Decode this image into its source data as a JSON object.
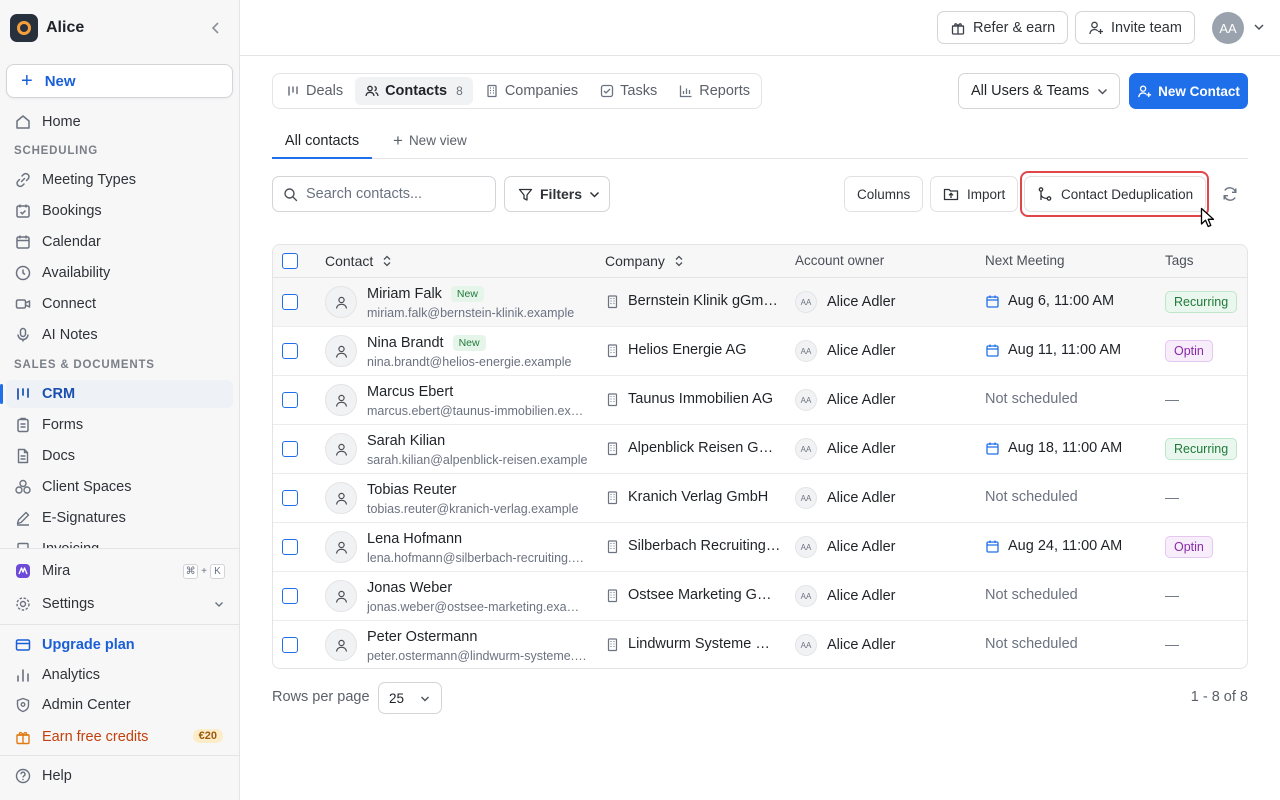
{
  "workspace": {
    "name": "Alice"
  },
  "sidebar": {
    "new_label": "New",
    "home_label": "Home",
    "section_scheduling": "SCHEDULING",
    "section_sales": "SALES & DOCUMENTS",
    "items": [
      {
        "label": "Meeting Types",
        "icon": "link-icon"
      },
      {
        "label": "Bookings",
        "icon": "calendar-check-icon"
      },
      {
        "label": "Calendar",
        "icon": "calendar-icon"
      },
      {
        "label": "Availability",
        "icon": "clock-icon"
      },
      {
        "label": "Connect",
        "icon": "video-icon"
      },
      {
        "label": "AI Notes",
        "icon": "mic-icon"
      },
      {
        "label": "CRM",
        "icon": "crm-icon",
        "active": true
      },
      {
        "label": "Forms",
        "icon": "clipboard-icon"
      },
      {
        "label": "Docs",
        "icon": "doc-icon"
      },
      {
        "label": "Client Spaces",
        "icon": "grid-icon"
      },
      {
        "label": "E-Signatures",
        "icon": "pen-icon"
      },
      {
        "label": "Invoicing",
        "icon": "invoice-icon"
      }
    ],
    "mira_label": "Mira",
    "mira_shortcut_1": "⌘",
    "mira_shortcut_plus": "+",
    "mira_shortcut_2": "K",
    "settings_label": "Settings",
    "upgrade_label": "Upgrade plan",
    "analytics_label": "Analytics",
    "admin_label": "Admin Center",
    "earn_label": "Earn free credits",
    "earn_badge": "€20",
    "help_label": "Help"
  },
  "topbar": {
    "refer_label": "Refer & earn",
    "invite_label": "Invite team",
    "avatar_initials": "AA"
  },
  "tabs": [
    {
      "label": "Deals",
      "icon": "deals-icon"
    },
    {
      "label": "Contacts",
      "icon": "users-icon",
      "count": "8",
      "active": true
    },
    {
      "label": "Companies",
      "icon": "building-icon"
    },
    {
      "label": "Tasks",
      "icon": "checkbox-icon"
    },
    {
      "label": "Reports",
      "icon": "chart-icon"
    }
  ],
  "users_filter": "All Users & Teams",
  "new_contact_label": "New Contact",
  "views": {
    "active": "All contacts",
    "new_view": "New view"
  },
  "toolbar": {
    "search_placeholder": "Search contacts...",
    "filters_label": "Filters",
    "columns_label": "Columns",
    "import_label": "Import",
    "dedupe_label": "Contact Deduplication"
  },
  "table": {
    "headers": {
      "contact": "Contact",
      "company": "Company",
      "owner": "Account owner",
      "meeting": "Next Meeting",
      "tags": "Tags"
    },
    "rows": [
      {
        "name": "Miriam Falk",
        "badge": "New",
        "email": "miriam.falk@bernstein-klinik.example",
        "company": "Bernstein Klinik gGmbH",
        "owner_initials": "AA",
        "owner": "Alice Adler",
        "meeting": "Aug 6, 11:00 AM",
        "tag": "Recurring"
      },
      {
        "name": "Nina Brandt",
        "badge": "New",
        "email": "nina.brandt@helios-energie.example",
        "company": "Helios Energie AG",
        "owner_initials": "AA",
        "owner": "Alice Adler",
        "meeting": "Aug 11, 11:00 AM",
        "tag": "Optin"
      },
      {
        "name": "Marcus Ebert",
        "badge": "",
        "email": "marcus.ebert@taunus-immobilien.example",
        "company": "Taunus Immobilien AG",
        "owner_initials": "AA",
        "owner": "Alice Adler",
        "meeting": "Not scheduled",
        "tag": "—"
      },
      {
        "name": "Sarah Kilian",
        "badge": "",
        "email": "sarah.kilian@alpenblick-reisen.example",
        "company": "Alpenblick Reisen GmbH",
        "owner_initials": "AA",
        "owner": "Alice Adler",
        "meeting": "Aug 18, 11:00 AM",
        "tag": "Recurring"
      },
      {
        "name": "Tobias Reuter",
        "badge": "",
        "email": "tobias.reuter@kranich-verlag.example",
        "company": "Kranich Verlag GmbH",
        "owner_initials": "AA",
        "owner": "Alice Adler",
        "meeting": "Not scheduled",
        "tag": "—"
      },
      {
        "name": "Lena Hofmann",
        "badge": "",
        "email": "lena.hofmann@silberbach-recruiting.example",
        "company": "Silberbach Recruiting GmbH",
        "owner_initials": "AA",
        "owner": "Alice Adler",
        "meeting": "Aug 24, 11:00 AM",
        "tag": "Optin"
      },
      {
        "name": "Jonas Weber",
        "badge": "",
        "email": "jonas.weber@ostsee-marketing.example",
        "company": "Ostsee Marketing GmbH",
        "owner_initials": "AA",
        "owner": "Alice Adler",
        "meeting": "Not scheduled",
        "tag": "—"
      },
      {
        "name": "Peter Ostermann",
        "badge": "",
        "email": "peter.ostermann@lindwurm-systeme.example",
        "company": "Lindwurm Systeme GmbH",
        "owner_initials": "AA",
        "owner": "Alice Adler",
        "meeting": "Not scheduled",
        "tag": "—"
      }
    ]
  },
  "footer": {
    "rows_per_page_label": "Rows per page",
    "rows_per_page": "25",
    "pagination": "1 - 8 of 8"
  },
  "colors": {
    "accent": "#1f6feb",
    "highlight": "#e0454a",
    "tag_green": "#1f7a39",
    "tag_purple": "#8a2aa8"
  }
}
